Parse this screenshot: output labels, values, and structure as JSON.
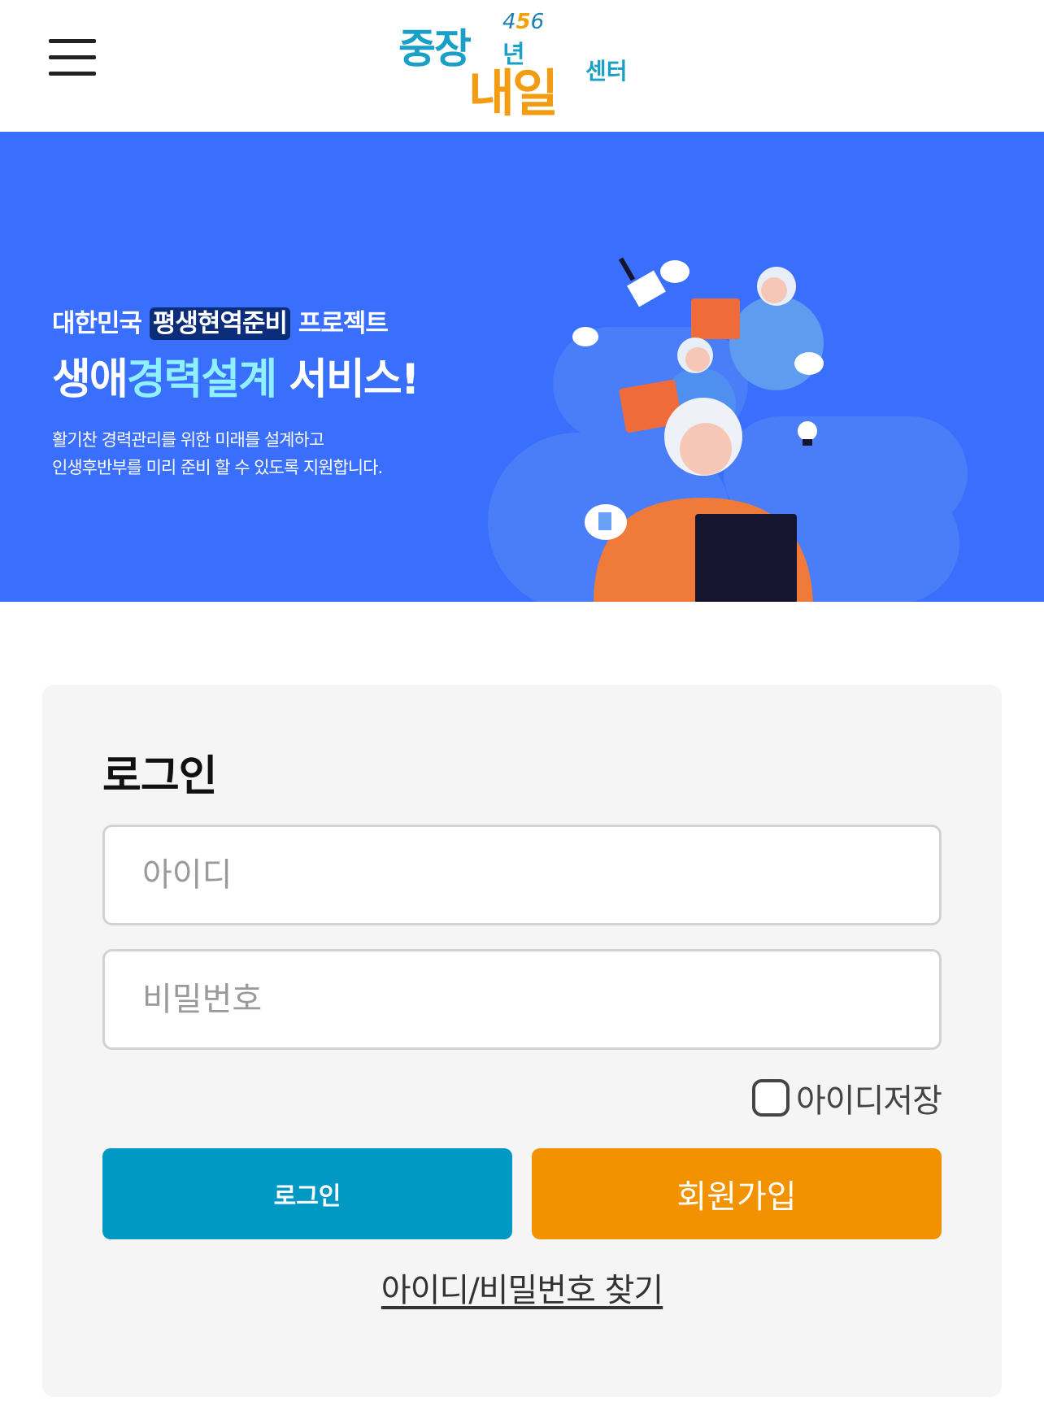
{
  "header": {
    "logo": {
      "part1": "중장",
      "part1b": "년",
      "numbers_a": "4",
      "numbers_b": "5",
      "numbers_c": "6",
      "part2": "내일",
      "part3": "센터"
    }
  },
  "banner": {
    "line1_prefix": "대한민국",
    "line1_highlight": "평생현역준비",
    "line1_suffix": "프로젝트",
    "line2_prefix": "생애",
    "line2_highlight": "경력설계",
    "line2_suffix": "서비스!",
    "desc_line1": "활기찬 경력관리를 위한 미래를 설계하고",
    "desc_line2": "인생후반부를 미리 준비 할 수 있도록 지원합니다.",
    "colors": {
      "background": "#3a6efc",
      "highlight_bg": "#0b2d7a",
      "highlight_text": "#8ff0ff"
    }
  },
  "login": {
    "title": "로그인",
    "id_placeholder": "아이디",
    "pw_placeholder": "비밀번호",
    "save_id_label": "아이디저장",
    "save_id_checked": false,
    "login_button": "로그인",
    "join_button": "회원가입",
    "find_link": "아이디/비밀번호 찾기",
    "colors": {
      "login_button": "#0099c4",
      "join_button": "#f39200",
      "card_bg": "#f5f5f5"
    }
  }
}
